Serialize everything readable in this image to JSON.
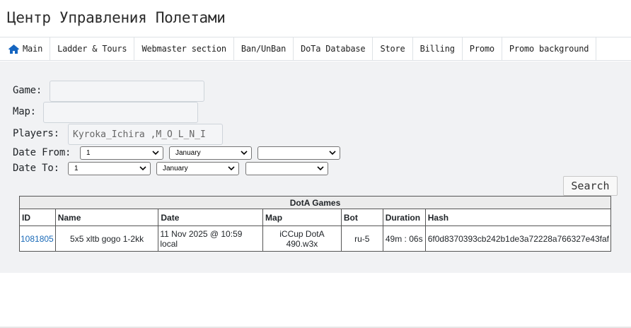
{
  "header": {
    "title": "Центр Управления Полетами"
  },
  "nav": {
    "items": [
      {
        "label": "Main",
        "icon": "home-icon"
      },
      {
        "label": "Ladder & Tours"
      },
      {
        "label": "Webmaster section"
      },
      {
        "label": "Ban/UnBan"
      },
      {
        "label": "DoTa Database"
      },
      {
        "label": "Store"
      },
      {
        "label": "Billing"
      },
      {
        "label": "Promo"
      },
      {
        "label": "Promo background"
      }
    ]
  },
  "form": {
    "game_label": "Game:",
    "game_value": "",
    "map_label": "Map:",
    "map_value": "",
    "players_label": "Players:",
    "players_value": "Kyroka_Ichira ,M_O_L_N_I",
    "date_from_label": "Date From:",
    "date_from": {
      "day": "1",
      "month": "January",
      "year": ""
    },
    "date_to_label": "Date To:",
    "date_to": {
      "day": "1",
      "month": "January",
      "year": ""
    },
    "search_label": "Search"
  },
  "table": {
    "caption": "DotA Games",
    "columns": [
      "ID",
      "Name",
      "Date",
      "Map",
      "Bot",
      "Duration",
      "Hash"
    ],
    "rows": [
      {
        "id": "1081805",
        "name": "5x5 xltb gogo 1-2kk",
        "date": "11 Nov 2025 @ 10:59 local",
        "map_line1": "iCCup DotA",
        "map_line2": "490.w3x",
        "bot": "ru-5",
        "duration": "49m : 06s",
        "hash": "6f0d8370393cb242b1de3a72228a766327e43faf"
      }
    ]
  },
  "colors": {
    "link": "#1a6ab8",
    "home_icon": "#1565c0",
    "main_background": "#f1f2f4"
  }
}
